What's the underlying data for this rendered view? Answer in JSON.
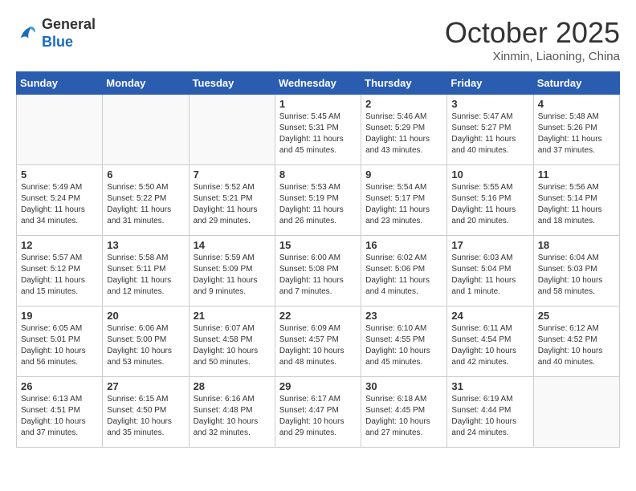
{
  "header": {
    "logo": {
      "general": "General",
      "blue": "Blue"
    },
    "month": "October 2025",
    "location": "Xinmin, Liaoning, China"
  },
  "weekdays": [
    "Sunday",
    "Monday",
    "Tuesday",
    "Wednesday",
    "Thursday",
    "Friday",
    "Saturday"
  ],
  "weeks": [
    [
      {
        "day": "",
        "info": ""
      },
      {
        "day": "",
        "info": ""
      },
      {
        "day": "",
        "info": ""
      },
      {
        "day": "1",
        "info": "Sunrise: 5:45 AM\nSunset: 5:31 PM\nDaylight: 11 hours and 45 minutes."
      },
      {
        "day": "2",
        "info": "Sunrise: 5:46 AM\nSunset: 5:29 PM\nDaylight: 11 hours and 43 minutes."
      },
      {
        "day": "3",
        "info": "Sunrise: 5:47 AM\nSunset: 5:27 PM\nDaylight: 11 hours and 40 minutes."
      },
      {
        "day": "4",
        "info": "Sunrise: 5:48 AM\nSunset: 5:26 PM\nDaylight: 11 hours and 37 minutes."
      }
    ],
    [
      {
        "day": "5",
        "info": "Sunrise: 5:49 AM\nSunset: 5:24 PM\nDaylight: 11 hours and 34 minutes."
      },
      {
        "day": "6",
        "info": "Sunrise: 5:50 AM\nSunset: 5:22 PM\nDaylight: 11 hours and 31 minutes."
      },
      {
        "day": "7",
        "info": "Sunrise: 5:52 AM\nSunset: 5:21 PM\nDaylight: 11 hours and 29 minutes."
      },
      {
        "day": "8",
        "info": "Sunrise: 5:53 AM\nSunset: 5:19 PM\nDaylight: 11 hours and 26 minutes."
      },
      {
        "day": "9",
        "info": "Sunrise: 5:54 AM\nSunset: 5:17 PM\nDaylight: 11 hours and 23 minutes."
      },
      {
        "day": "10",
        "info": "Sunrise: 5:55 AM\nSunset: 5:16 PM\nDaylight: 11 hours and 20 minutes."
      },
      {
        "day": "11",
        "info": "Sunrise: 5:56 AM\nSunset: 5:14 PM\nDaylight: 11 hours and 18 minutes."
      }
    ],
    [
      {
        "day": "12",
        "info": "Sunrise: 5:57 AM\nSunset: 5:12 PM\nDaylight: 11 hours and 15 minutes."
      },
      {
        "day": "13",
        "info": "Sunrise: 5:58 AM\nSunset: 5:11 PM\nDaylight: 11 hours and 12 minutes."
      },
      {
        "day": "14",
        "info": "Sunrise: 5:59 AM\nSunset: 5:09 PM\nDaylight: 11 hours and 9 minutes."
      },
      {
        "day": "15",
        "info": "Sunrise: 6:00 AM\nSunset: 5:08 PM\nDaylight: 11 hours and 7 minutes."
      },
      {
        "day": "16",
        "info": "Sunrise: 6:02 AM\nSunset: 5:06 PM\nDaylight: 11 hours and 4 minutes."
      },
      {
        "day": "17",
        "info": "Sunrise: 6:03 AM\nSunset: 5:04 PM\nDaylight: 11 hours and 1 minute."
      },
      {
        "day": "18",
        "info": "Sunrise: 6:04 AM\nSunset: 5:03 PM\nDaylight: 10 hours and 58 minutes."
      }
    ],
    [
      {
        "day": "19",
        "info": "Sunrise: 6:05 AM\nSunset: 5:01 PM\nDaylight: 10 hours and 56 minutes."
      },
      {
        "day": "20",
        "info": "Sunrise: 6:06 AM\nSunset: 5:00 PM\nDaylight: 10 hours and 53 minutes."
      },
      {
        "day": "21",
        "info": "Sunrise: 6:07 AM\nSunset: 4:58 PM\nDaylight: 10 hours and 50 minutes."
      },
      {
        "day": "22",
        "info": "Sunrise: 6:09 AM\nSunset: 4:57 PM\nDaylight: 10 hours and 48 minutes."
      },
      {
        "day": "23",
        "info": "Sunrise: 6:10 AM\nSunset: 4:55 PM\nDaylight: 10 hours and 45 minutes."
      },
      {
        "day": "24",
        "info": "Sunrise: 6:11 AM\nSunset: 4:54 PM\nDaylight: 10 hours and 42 minutes."
      },
      {
        "day": "25",
        "info": "Sunrise: 6:12 AM\nSunset: 4:52 PM\nDaylight: 10 hours and 40 minutes."
      }
    ],
    [
      {
        "day": "26",
        "info": "Sunrise: 6:13 AM\nSunset: 4:51 PM\nDaylight: 10 hours and 37 minutes."
      },
      {
        "day": "27",
        "info": "Sunrise: 6:15 AM\nSunset: 4:50 PM\nDaylight: 10 hours and 35 minutes."
      },
      {
        "day": "28",
        "info": "Sunrise: 6:16 AM\nSunset: 4:48 PM\nDaylight: 10 hours and 32 minutes."
      },
      {
        "day": "29",
        "info": "Sunrise: 6:17 AM\nSunset: 4:47 PM\nDaylight: 10 hours and 29 minutes."
      },
      {
        "day": "30",
        "info": "Sunrise: 6:18 AM\nSunset: 4:45 PM\nDaylight: 10 hours and 27 minutes."
      },
      {
        "day": "31",
        "info": "Sunrise: 6:19 AM\nSunset: 4:44 PM\nDaylight: 10 hours and 24 minutes."
      },
      {
        "day": "",
        "info": ""
      }
    ]
  ]
}
